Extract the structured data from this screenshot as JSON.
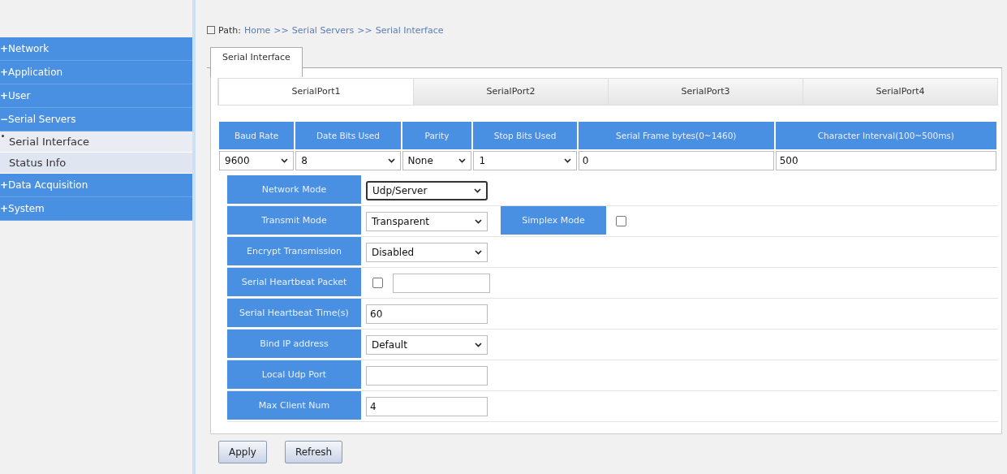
{
  "sidebar": {
    "items": [
      {
        "sign": "+",
        "label": "Network"
      },
      {
        "sign": "+",
        "label": "Application"
      },
      {
        "sign": "+",
        "label": "User"
      },
      {
        "sign": "−",
        "label": "Serial Servers",
        "children": [
          {
            "label": "Serial Interface",
            "selected": true
          },
          {
            "label": "Status Info",
            "selected": false
          }
        ]
      },
      {
        "sign": "+",
        "label": "Data Acquisition"
      },
      {
        "sign": "+",
        "label": "System"
      }
    ]
  },
  "path": {
    "label": "Path:",
    "crumbs": [
      "Home",
      ">>",
      "Serial Servers",
      ">>",
      "Serial Interface"
    ]
  },
  "page_tabs": [
    {
      "label": "Serial Interface",
      "selected": true
    }
  ],
  "port_tabs": [
    {
      "label": "SerialPort1",
      "selected": true
    },
    {
      "label": "SerialPort2",
      "selected": false
    },
    {
      "label": "SerialPort3",
      "selected": false
    },
    {
      "label": "SerialPort4",
      "selected": false
    }
  ],
  "serial_table": {
    "columns": [
      "Baud Rate",
      "Date Bits Used",
      "Parity",
      "Stop Bits Used",
      "Serial Frame bytes(0~1460)",
      "Character Interval(100~500ms)"
    ],
    "values": [
      {
        "kind": "select",
        "value": "9600"
      },
      {
        "kind": "select",
        "value": "8"
      },
      {
        "kind": "select",
        "value": "None"
      },
      {
        "kind": "select",
        "value": "1"
      },
      {
        "kind": "input",
        "value": "0"
      },
      {
        "kind": "input",
        "value": "500"
      }
    ]
  },
  "settings": [
    {
      "label": "Network Mode",
      "kind": "select",
      "value": "Udp/Server",
      "focused": true
    },
    {
      "label": "Transmit Mode",
      "kind": "select",
      "value": "Transparent",
      "extra": {
        "label": "Simplex Mode",
        "checked": false
      }
    },
    {
      "label": "Encrypt Transmission",
      "kind": "select",
      "value": "Disabled"
    },
    {
      "label": "Serial Heartbeat Packet",
      "kind": "check-input",
      "checked": false
    },
    {
      "label": "Serial Heartbeat Time(s)",
      "kind": "input",
      "value": "60"
    },
    {
      "label": "Bind IP address",
      "kind": "select",
      "value": "Default"
    },
    {
      "label": "Local Udp Port",
      "kind": "input"
    },
    {
      "label": "Max Client Num",
      "kind": "input",
      "value": "4"
    }
  ],
  "buttons": [
    "Apply",
    "Refresh"
  ]
}
